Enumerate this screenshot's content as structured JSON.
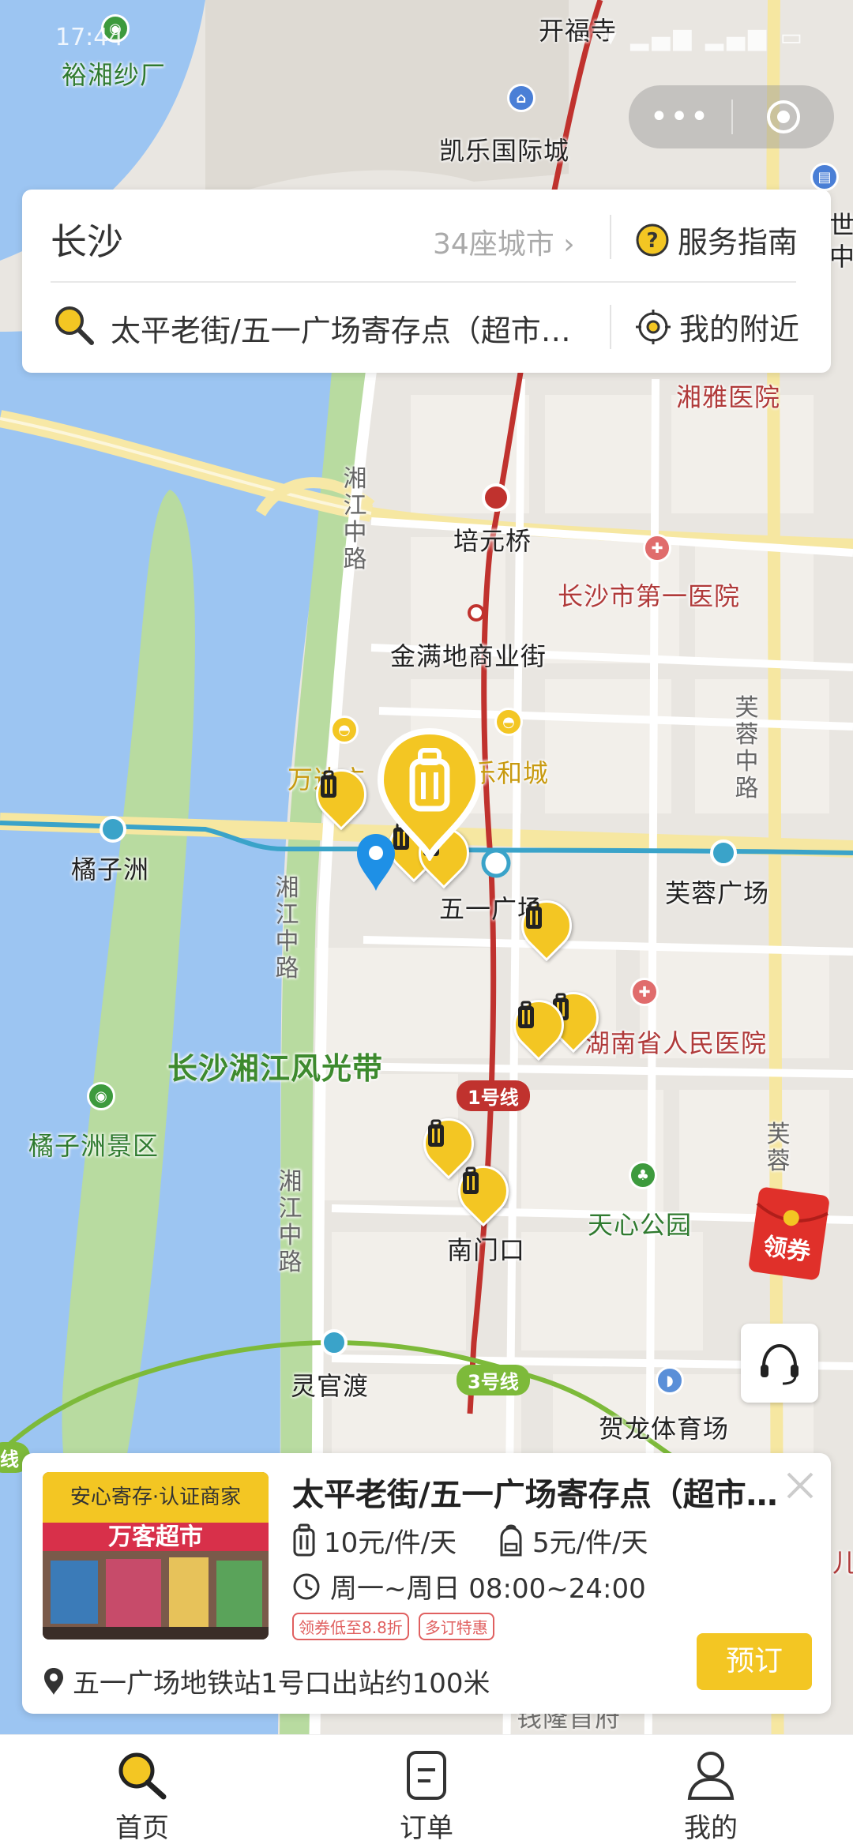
{
  "status_bar": {
    "time": "17:44",
    "icons": "⌁ ▾ ▂▄▆ ▂▄▆ ▭"
  },
  "capsule": {
    "more_label": "•••"
  },
  "top_card": {
    "city": "长沙",
    "city_count": "34座城市 ›",
    "guide_label": "服务指南",
    "search_text": "太平老街/五一广场寄存点（超市…",
    "nearby_label": "我的附近"
  },
  "map": {
    "labels": {
      "kaifusi": "开福寺",
      "yuxiang": "裕湘纱厂",
      "kaile": "凯乐国际城",
      "xiangya": "湘雅医院",
      "shi": "世",
      "zhong": "中",
      "peiyuan": "培元桥",
      "shidiyi": "长沙市第一医院",
      "jinmandi": "金满地商业街",
      "wanda": "万达广",
      "lehecheng": "乐和城",
      "juzizhou": "橘子洲",
      "wuyi": "五一广场",
      "furong_sq": "芙蓉广场",
      "shengrenmin": "湖南省人民医院",
      "fengguang": "长沙湘江风光带",
      "juzizhou_scenic": "橘子洲景区",
      "tianxin": "天心公园",
      "nanmenkou": "南门口",
      "lingguandu": "灵官渡",
      "helong": "贺龙体育场",
      "xiangjiang_road_1": "湘江中路",
      "xiangjiang_road_2": "湘江中路",
      "xiangjiang_road_3": "湘江中路",
      "furong_road": "芙蓉中路",
      "furong_road_2": "芙蓉",
      "qianlong": "钱隆首府",
      "liu": "儿"
    },
    "line1_label": "1号线",
    "line3_label": "3号线",
    "line_edge": "线"
  },
  "coupon": {
    "label": "领券"
  },
  "store_card": {
    "badge": "安心寄存·认证商家",
    "photo_sign": "万客超市",
    "title": "太平老街/五一广场寄存点（超市…",
    "price_large": "10元/件/天",
    "price_small": "5元/件/天",
    "hours": "周一~周日 08:00~24:00",
    "tags": [
      "领券低至8.8折",
      "多订特惠"
    ],
    "address": "五一广场地铁站1号口出站约100米",
    "book_label": "预订"
  },
  "tab_bar": {
    "items": [
      {
        "label": "首页",
        "icon": "search-icon",
        "active": true
      },
      {
        "label": "订单",
        "icon": "order-icon",
        "active": false
      },
      {
        "label": "我的",
        "icon": "profile-icon",
        "active": false
      }
    ]
  },
  "colors": {
    "accent": "#f3c623",
    "river": "#9cc5f2",
    "land": "#e9e6e1",
    "green": "#b8dba0",
    "metro_line1": "#c0322e",
    "metro_line2": "#3aa3c9",
    "metro_line3": "#7dba3a"
  }
}
